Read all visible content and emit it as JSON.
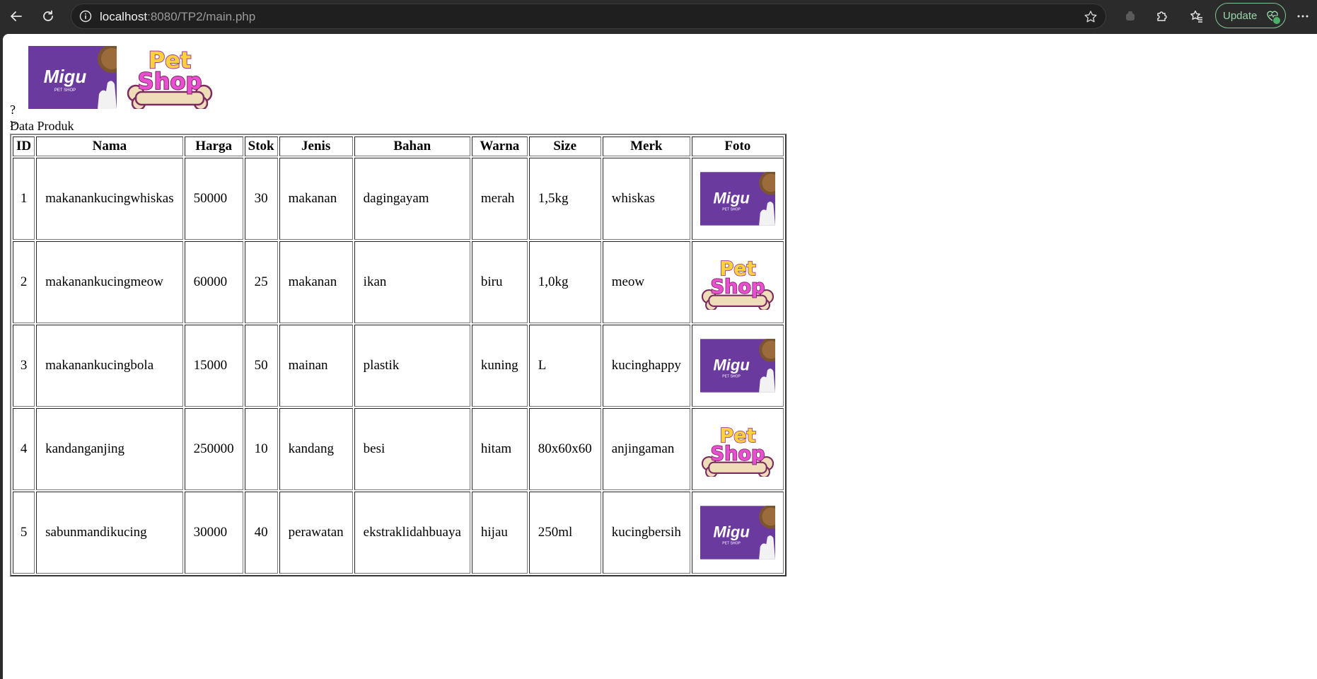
{
  "browser": {
    "url_host": "localhost",
    "url_path": ":8080/TP2/main.php",
    "update_label": "Update"
  },
  "page": {
    "stray_text": "?>",
    "caption": "Data Produk",
    "logo_migu_text": "Migu",
    "logo_migu_sub": "PET SHOP",
    "logo_pet_line1": "Pet",
    "logo_pet_line2": "Shop"
  },
  "table": {
    "headers": [
      "ID",
      "Nama",
      "Harga",
      "Stok",
      "Jenis",
      "Bahan",
      "Warna",
      "Size",
      "Merk",
      "Foto"
    ],
    "rows": [
      {
        "id": "1",
        "nama": "makanankucingwhiskas",
        "harga": "50000",
        "stok": "30",
        "jenis": "makanan",
        "bahan": "dagingayam",
        "warna": "merah",
        "size": "1,5kg",
        "merk": "whiskas",
        "foto": "migu"
      },
      {
        "id": "2",
        "nama": "makanankucingmeow",
        "harga": "60000",
        "stok": "25",
        "jenis": "makanan",
        "bahan": "ikan",
        "warna": "biru",
        "size": "1,0kg",
        "merk": "meow",
        "foto": "petshop"
      },
      {
        "id": "3",
        "nama": "makanankucingbola",
        "harga": "15000",
        "stok": "50",
        "jenis": "mainan",
        "bahan": "plastik",
        "warna": "kuning",
        "size": "L",
        "merk": "kucinghappy",
        "foto": "migu"
      },
      {
        "id": "4",
        "nama": "kandanganjing",
        "harga": "250000",
        "stok": "10",
        "jenis": "kandang",
        "bahan": "besi",
        "warna": "hitam",
        "size": "80x60x60",
        "merk": "anjingaman",
        "foto": "petshop"
      },
      {
        "id": "5",
        "nama": "sabunmandikucing",
        "harga": "30000",
        "stok": "40",
        "jenis": "perawatan",
        "bahan": "ekstraklidahbuaya",
        "warna": "hijau",
        "size": "250ml",
        "merk": "kucingbersih",
        "foto": "migu"
      }
    ]
  },
  "colors": {
    "migu_purple": "#6b3a9e",
    "pet_yellow": "#ffd23c",
    "pet_pink": "#e94fd0",
    "bone": "#efdcb8"
  }
}
